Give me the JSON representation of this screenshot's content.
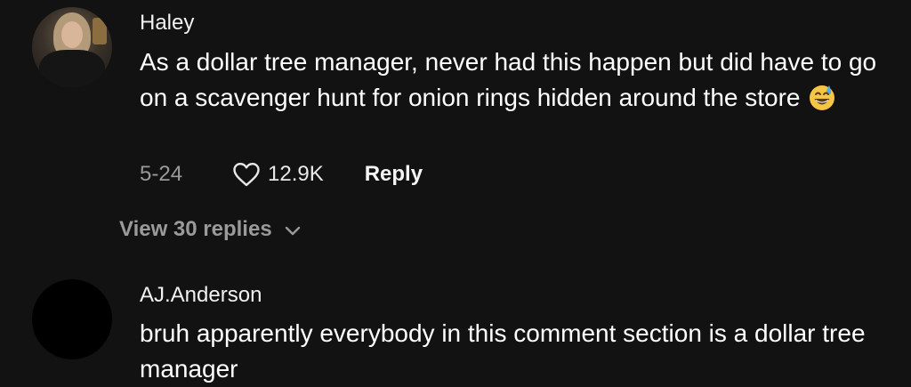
{
  "comments": [
    {
      "author": "Haley",
      "text_main": "As a dollar tree manager, never had this happen but did have to go on a scavenger hunt for onion rings hidden around the store",
      "emoji": "grinning-sweat-emoji",
      "date": "5-24",
      "likes": "12.9K",
      "reply_label": "Reply",
      "view_replies": "View 30 replies"
    },
    {
      "author": "AJ.Anderson",
      "text_main": "bruh apparently everybody in this comment section is a dollar tree manager"
    }
  ],
  "icons": {
    "like": "heart-outline-icon",
    "expand": "chevron-down-icon"
  },
  "colors": {
    "background": "#121212",
    "text_primary": "#ffffff",
    "text_secondary": "#9a9a9a"
  }
}
